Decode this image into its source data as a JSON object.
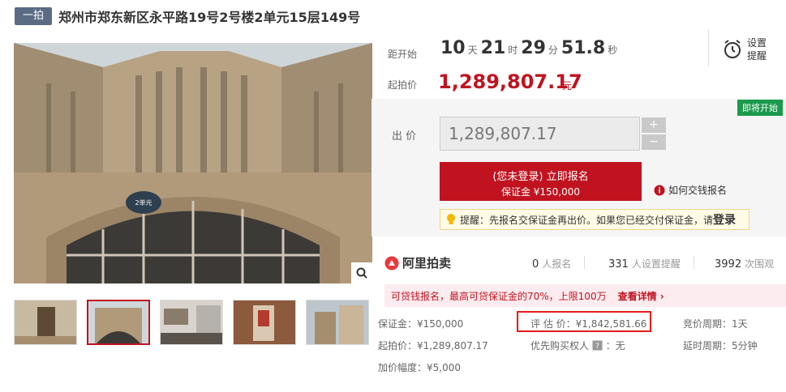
{
  "header": {
    "tag": "一拍",
    "title": "郑州市郑东新区永平路19号2号楼2单元15层149号"
  },
  "countdown": {
    "label": "距开始",
    "days": "10",
    "days_unit": "天",
    "hours": "21",
    "hours_unit": "时",
    "minutes": "29",
    "minutes_unit": "分",
    "seconds": "51.8",
    "seconds_unit": "秒"
  },
  "reminder_btn": {
    "line1": "设置",
    "line2": "提醒"
  },
  "start_price": {
    "label": "起拍价",
    "value": "1,289,807.17",
    "unit": "元"
  },
  "status_badge": "即将开始",
  "bid": {
    "label": "出 价",
    "value": "1,289,807.17",
    "plus": "+",
    "minus": "−"
  },
  "signup": {
    "line1": "(您未登录) 立即报名",
    "line2": "保证金 ¥150,000"
  },
  "howto": "如何交钱报名",
  "reminder": {
    "text": "提醒：先报名交保证金再出价。如果您已经交付保证金，请",
    "login": "登录"
  },
  "stats": {
    "logo": "阿里拍卖",
    "signups": "0",
    "signups_label": "人报名",
    "reminders": "331",
    "reminders_label": "人设置提醒",
    "views": "3992",
    "views_label": "次围观"
  },
  "loan": {
    "text": "可贷钱报名，最高可贷保证金的70%，上限100万",
    "detail": "查看详情 ›"
  },
  "details": {
    "deposit": "保证金：¥150,000",
    "appraisal": "评 估 价：¥1,842,581.66",
    "period": "竞价周期：1天",
    "start": "起拍价：¥1,289,807.17",
    "priority_label": "优先购买权人",
    "priority_value": "：无",
    "extension": "延时周期：5分钟",
    "increment": "加价幅度：¥5,000"
  },
  "colors": {
    "accent": "#c0131f",
    "tag": "#5b6b84",
    "badge": "#1a9a4b"
  }
}
